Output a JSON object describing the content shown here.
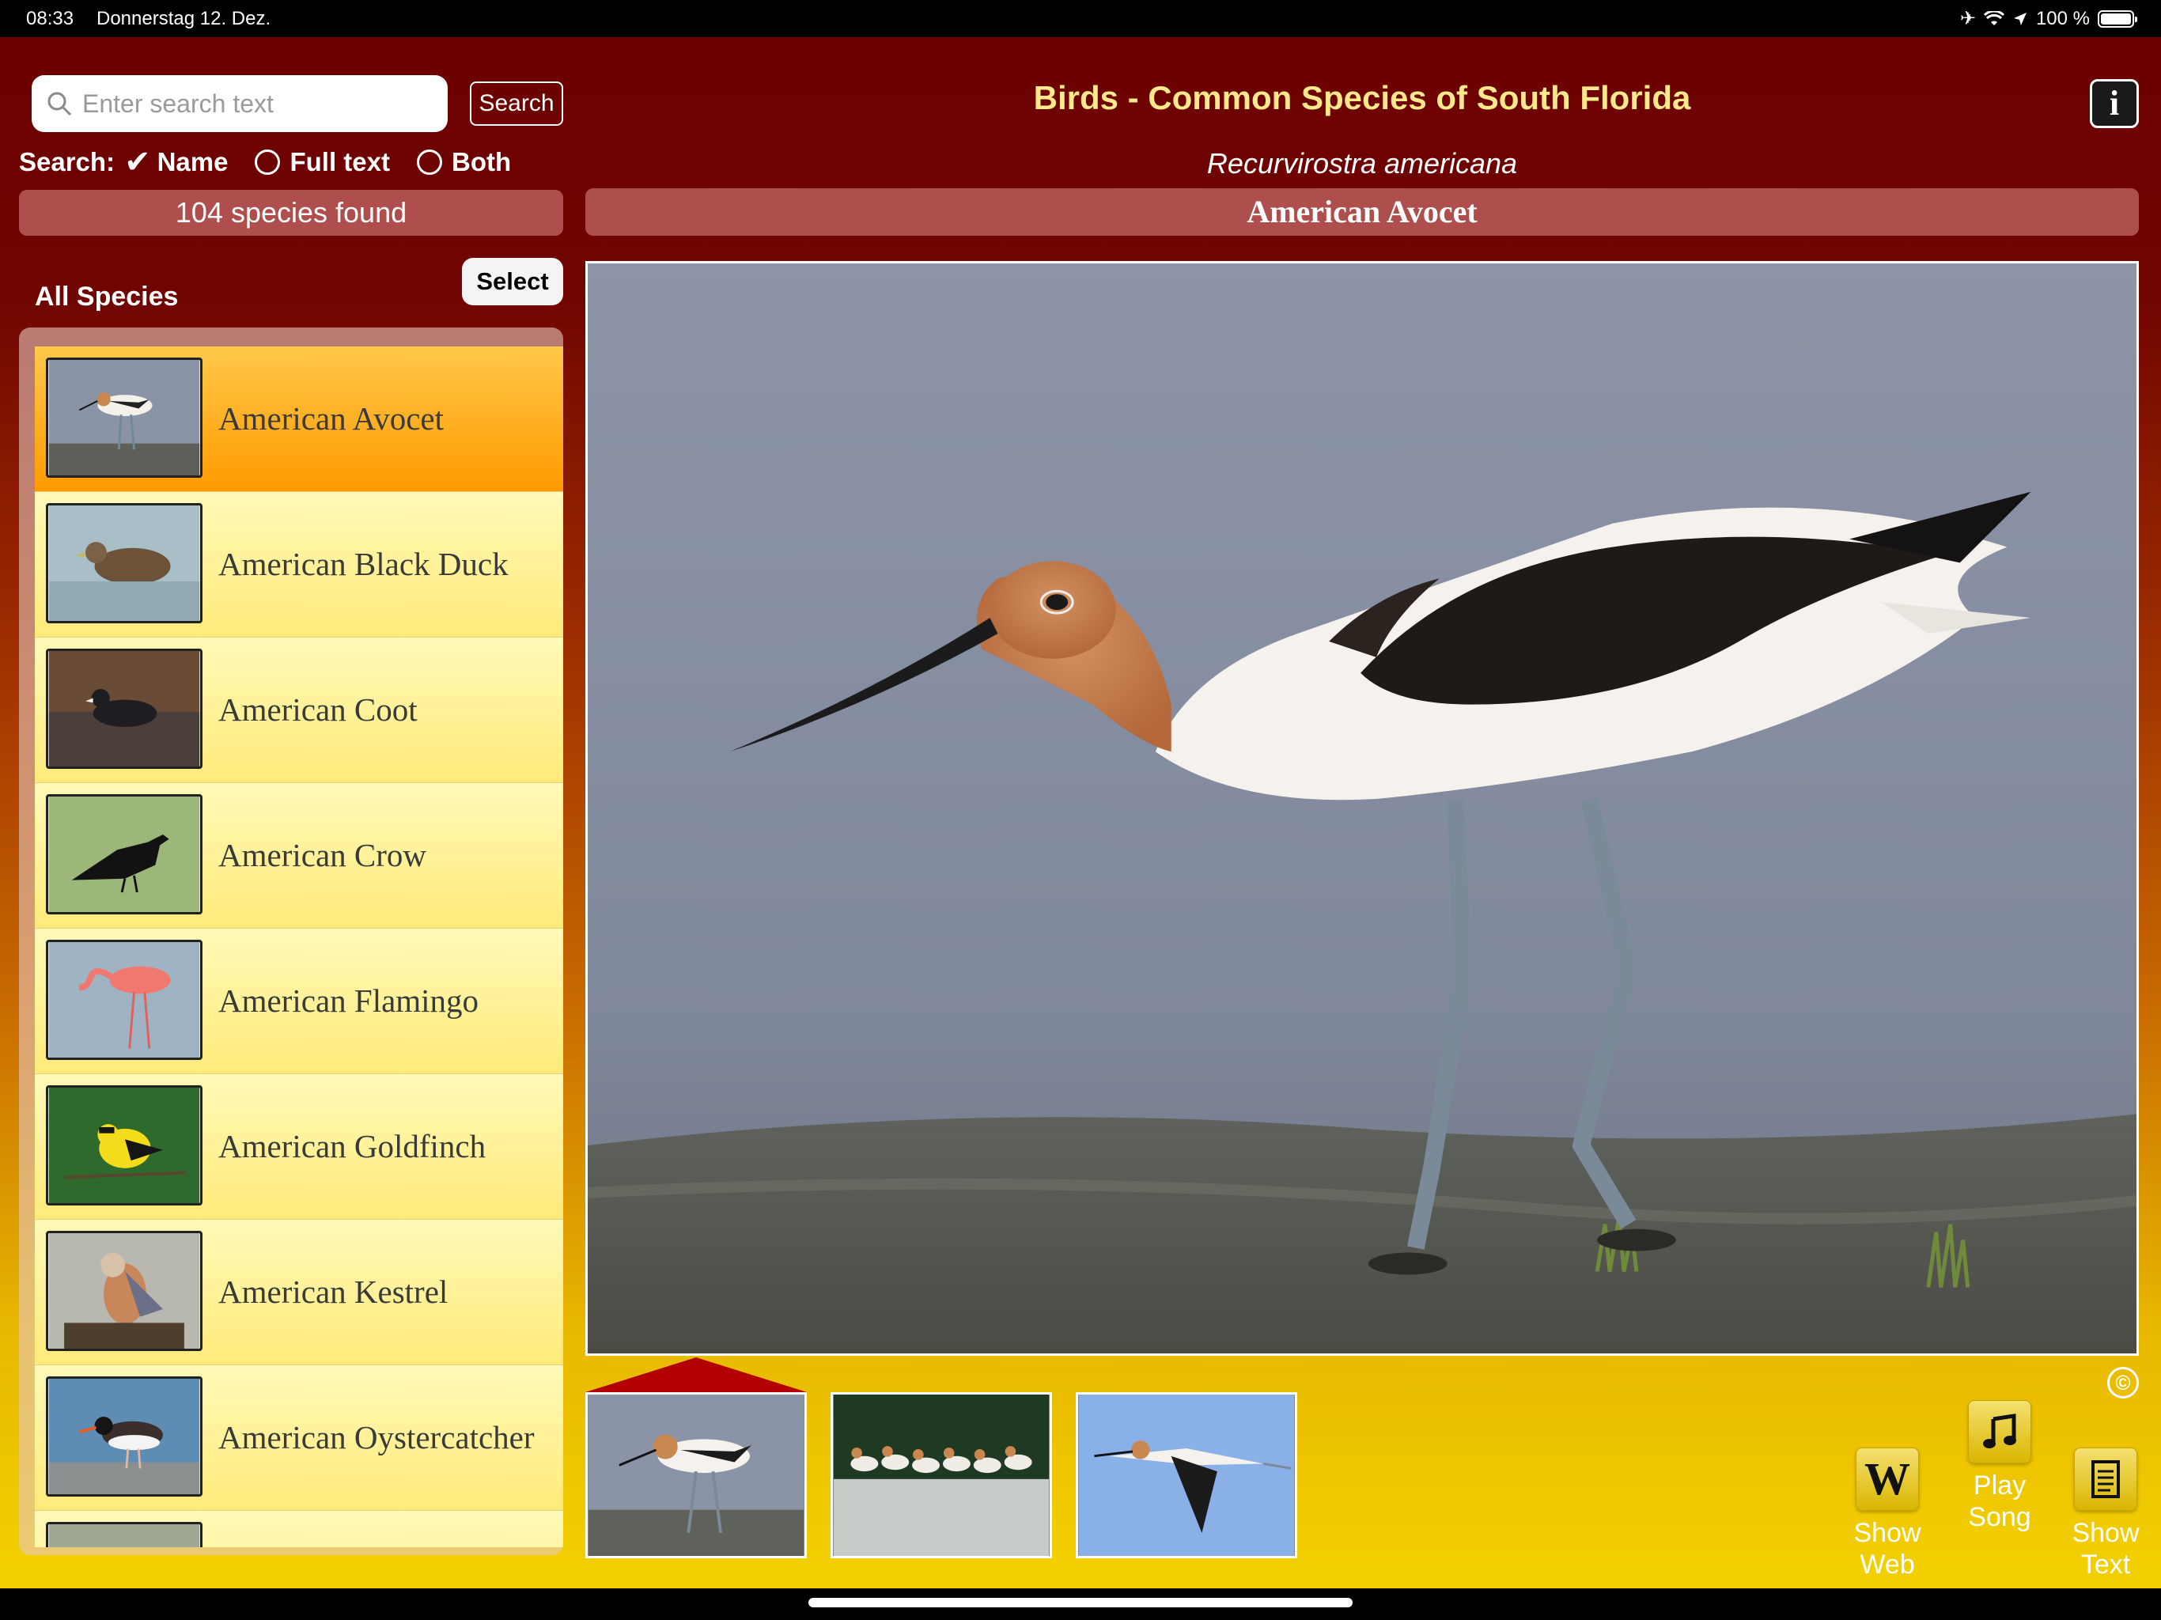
{
  "status": {
    "time": "08:33",
    "date": "Donnerstag 12. Dez.",
    "battery": "100 %"
  },
  "search": {
    "placeholder": "Enter search text",
    "button_label": "Search",
    "options_label": "Search:",
    "options": [
      {
        "label": "Name",
        "selected": true
      },
      {
        "label": "Full text",
        "selected": false
      },
      {
        "label": "Both",
        "selected": false
      }
    ],
    "results_count": "104 species found"
  },
  "species": {
    "heading": "All Species",
    "select_label": "Select",
    "items": [
      {
        "name": "American Avocet",
        "selected": true
      },
      {
        "name": "American Black Duck",
        "selected": false
      },
      {
        "name": "American Coot",
        "selected": false
      },
      {
        "name": "American Crow",
        "selected": false
      },
      {
        "name": "American Flamingo",
        "selected": false
      },
      {
        "name": "American Goldfinch",
        "selected": false
      },
      {
        "name": "American Kestrel",
        "selected": false
      },
      {
        "name": "American Oystercatcher",
        "selected": false
      }
    ]
  },
  "main": {
    "app_title": "Birds - Common Species of South Florida",
    "info_label": "i",
    "scientific_name": "Recurvirostra americana",
    "common_name": "American Avocet",
    "thumbs": [
      {
        "subject": "avocet-wading",
        "selected": true
      },
      {
        "subject": "avocet-flock",
        "selected": false
      },
      {
        "subject": "avocet-flight",
        "selected": false
      }
    ],
    "copyright_symbol": "©"
  },
  "actions": {
    "show_web": "Show Web",
    "play_song": "Play Song",
    "show_text": "Show Text",
    "web_icon": "W"
  },
  "colors": {
    "title": "#ffe98a",
    "selected_row": "#ff9a00",
    "row": "#fff9b8",
    "bar": "#b30000"
  }
}
